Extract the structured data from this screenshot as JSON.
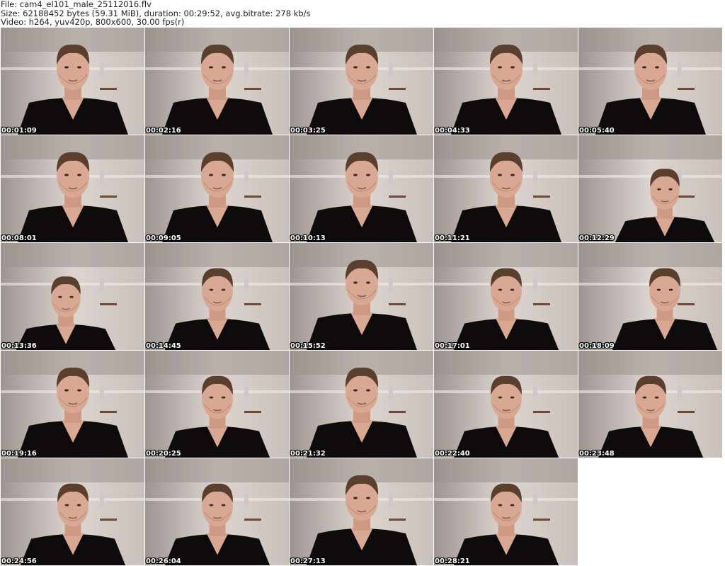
{
  "header": {
    "file_line": "File: cam4_el101_male_25112016.flv",
    "size_line": "Size: 62188452 bytes (59.31 MiB), duration: 00:29:52, avg.bitrate: 278 kb/s",
    "video_line": "Video: h264, yuv420p, 800x600, 30.00 fps(r)"
  },
  "thumbnails": [
    {
      "timestamp": "00:01:09"
    },
    {
      "timestamp": "00:02:16"
    },
    {
      "timestamp": "00:03:25"
    },
    {
      "timestamp": "00:04:33"
    },
    {
      "timestamp": "00:05:40"
    },
    {
      "timestamp": "00:08:01"
    },
    {
      "timestamp": "00:09:05"
    },
    {
      "timestamp": "00:10:13"
    },
    {
      "timestamp": "00:11:21"
    },
    {
      "timestamp": "00:12:29"
    },
    {
      "timestamp": "00:13:36"
    },
    {
      "timestamp": "00:14:45"
    },
    {
      "timestamp": "00:15:52"
    },
    {
      "timestamp": "00:17:01"
    },
    {
      "timestamp": "00:18:09"
    },
    {
      "timestamp": "00:19:16"
    },
    {
      "timestamp": "00:20:25"
    },
    {
      "timestamp": "00:21:32"
    },
    {
      "timestamp": "00:22:40"
    },
    {
      "timestamp": "00:23:48"
    },
    {
      "timestamp": "00:24:56"
    },
    {
      "timestamp": "00:26:04"
    },
    {
      "timestamp": "00:27:13"
    },
    {
      "timestamp": "00:28:21"
    }
  ],
  "colors": {
    "wall": "#ddd5cf",
    "wall_shadow": "#a89e98",
    "shirt": "#0e0b0c",
    "skin": "#d9a892",
    "hair": "#5a3f2e",
    "timestamp_text": "#ffffff"
  }
}
